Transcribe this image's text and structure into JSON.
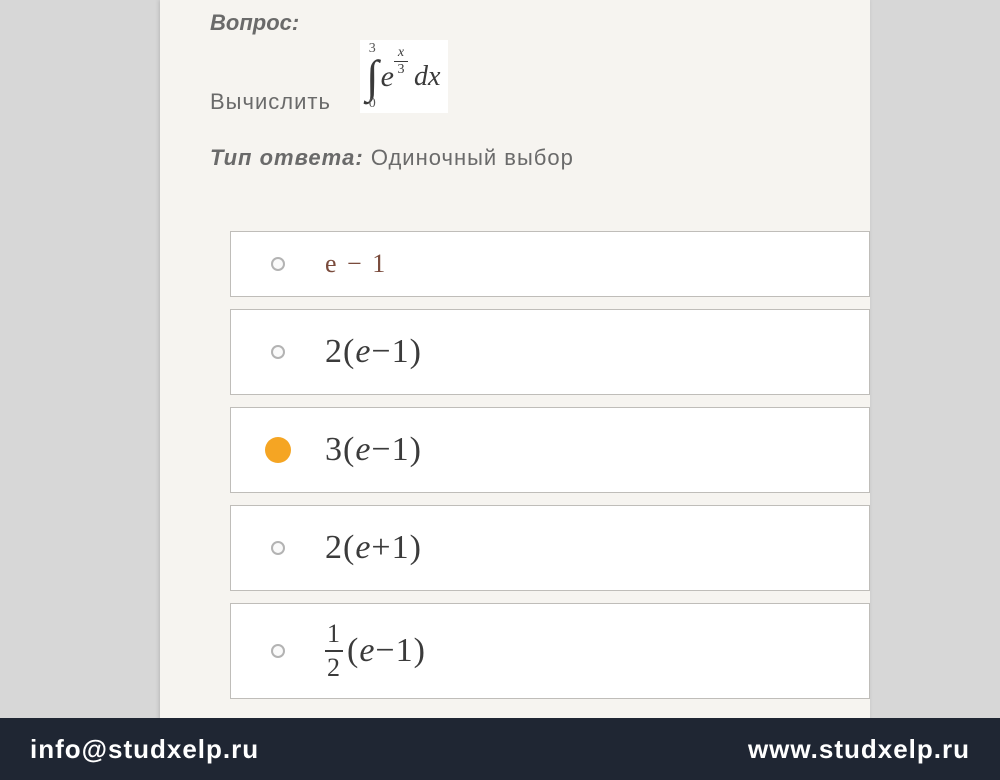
{
  "question": {
    "label": "Вопрос:",
    "compute_word": "Вычислить",
    "integral": {
      "upper": "3",
      "lower": "0",
      "base": "e",
      "exp_num": "x",
      "exp_den": "3",
      "dx": "dx"
    }
  },
  "answer_type": {
    "label": "Тип ответа:",
    "value": "Одиночный выбор"
  },
  "options": [
    {
      "id": "opt1",
      "selected": false,
      "display": "e − 1",
      "kind": "plain_small"
    },
    {
      "id": "opt2",
      "selected": false,
      "display": "2(e−1)",
      "kind": "expr",
      "coef": "2",
      "inner_e": "e",
      "op": "−",
      "one": "1"
    },
    {
      "id": "opt3",
      "selected": true,
      "display": "3(e−1)",
      "kind": "expr",
      "coef": "3",
      "inner_e": "e",
      "op": "−",
      "one": "1"
    },
    {
      "id": "opt4",
      "selected": false,
      "display": "2(e+1)",
      "kind": "expr",
      "coef": "2",
      "inner_e": "e",
      "op": "+",
      "one": "1"
    },
    {
      "id": "opt5",
      "selected": false,
      "display": "1/2 (e−1)",
      "kind": "frac",
      "frac_num": "1",
      "frac_den": "2",
      "inner_e": "e",
      "op": "−",
      "one": "1"
    }
  ],
  "footer": {
    "email": "info@studxelp.ru",
    "site": "www.studxelp.ru"
  }
}
